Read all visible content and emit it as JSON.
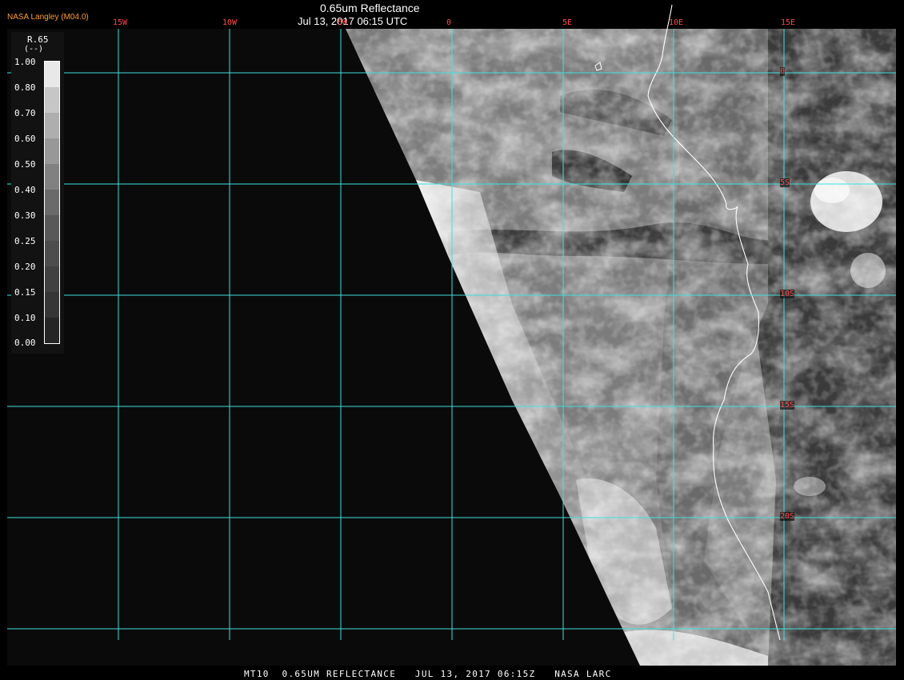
{
  "header": {
    "credit": "NASA Langley (M04.0)",
    "title": "0.65um Reflectance",
    "timestamp": "Jul 13, 2017 06:15 UTC"
  },
  "legend": {
    "name": "R.65",
    "unit": "(--)",
    "ticks": [
      "1.00",
      "0.80",
      "0.70",
      "0.60",
      "0.50",
      "0.40",
      "0.30",
      "0.25",
      "0.20",
      "0.15",
      "0.10",
      "0.00"
    ],
    "levels": [
      1.0,
      0.8,
      0.7,
      0.6,
      0.5,
      0.4,
      0.3,
      0.25,
      0.2,
      0.15,
      0.1,
      0.0
    ]
  },
  "grid": {
    "lon_labels": [
      "15W",
      "10W",
      "5W",
      "0",
      "5E",
      "10E",
      "15E"
    ],
    "lat_labels": [
      "0",
      "5S",
      "10S",
      "15S",
      "20S"
    ],
    "line_color": "#3fe0e0",
    "label_color": "#ff4a4a"
  },
  "footer": {
    "caption": "MT10  0.65UM REFLECTANCE   JUL 13, 2017 06:15Z   NASA LARC"
  },
  "colors": {
    "background": "#000000",
    "space": "#0a0a0a",
    "coastline": "#ffffff",
    "credit": "#ff9d2e"
  }
}
